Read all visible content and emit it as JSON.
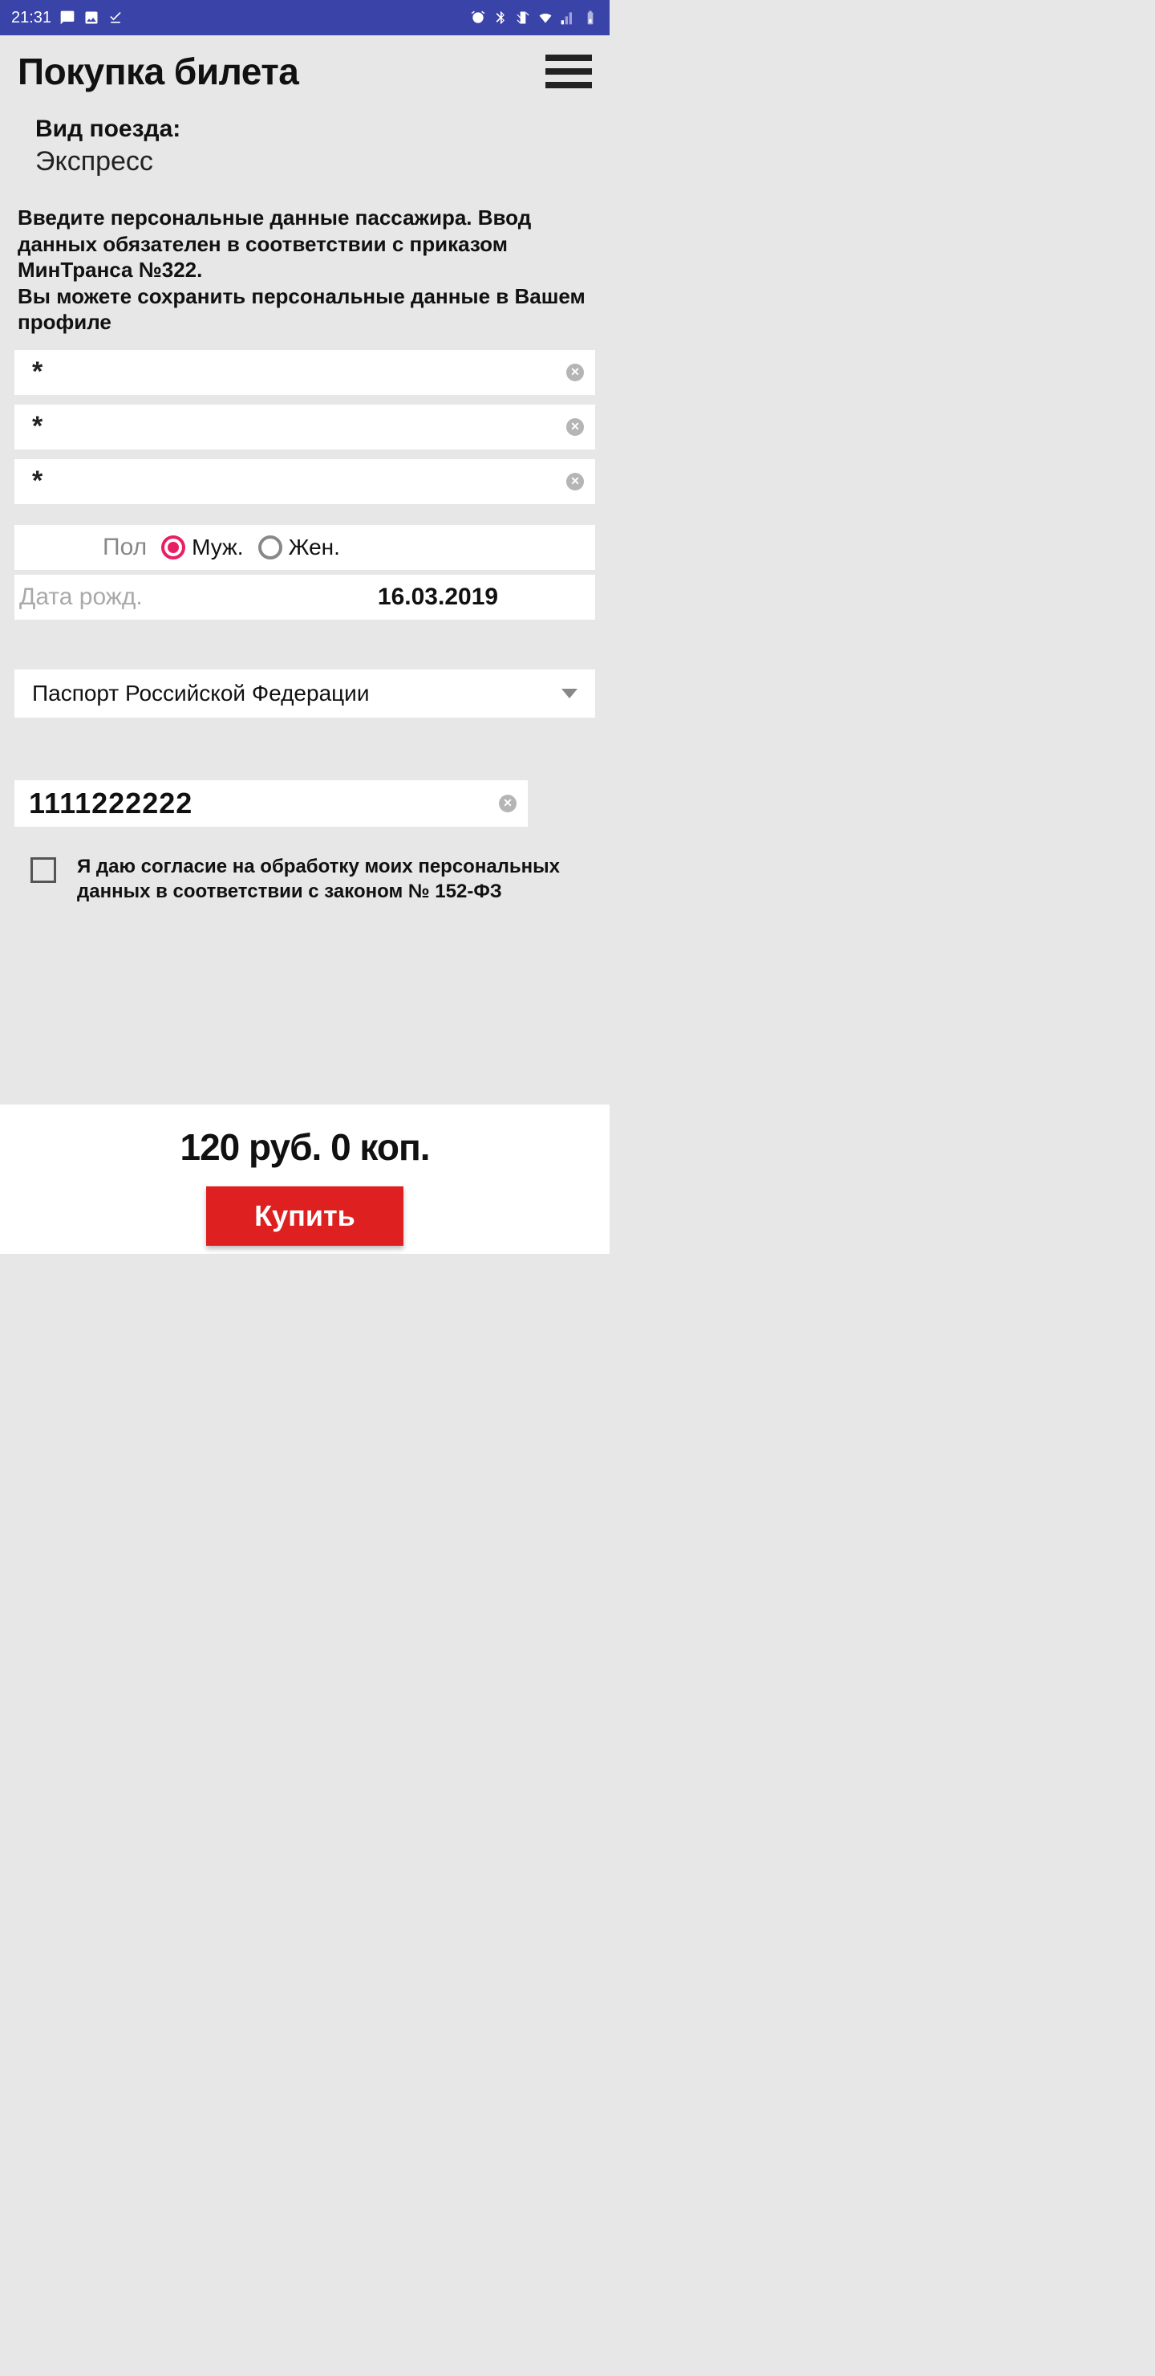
{
  "status": {
    "time": "21:31"
  },
  "header": {
    "title": "Покупка билета"
  },
  "train": {
    "label": "Вид поезда:",
    "value": "Экспресс"
  },
  "intro": "Введите персональные данные пассажира. Ввод данных обязателен в соответствии с приказом МинТранса №322.\nВы можете сохранить персональные данные в Вашем профиле",
  "fields": {
    "f1_placeholder": "*",
    "f2_placeholder": "*",
    "f3_placeholder": "*"
  },
  "gender": {
    "label": "Пол",
    "male": "Муж.",
    "female": "Жен.",
    "selected": "male"
  },
  "dob": {
    "label": "Дата рожд.",
    "value": "16.03.2019"
  },
  "doc": {
    "type": "Паспорт Российской Федерации",
    "number": "1111222222"
  },
  "consent": {
    "text": "Я даю согласие на обработку моих персональных данных в соответствии с законом № 152-ФЗ",
    "checked": false
  },
  "footer": {
    "price": "120 руб. 0 коп.",
    "buy": "Купить"
  }
}
